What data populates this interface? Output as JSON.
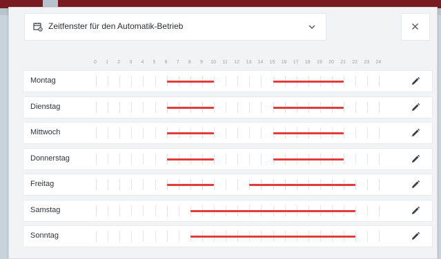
{
  "dialog": {
    "title": "Zeitfenster für den Automatik-Betrieb",
    "title_icon": "calendar-settings-icon",
    "chevron_icon": "chevron-down-icon",
    "close_icon": "close-icon"
  },
  "hours": [
    "0",
    "1",
    "2",
    "3",
    "4",
    "5",
    "6",
    "7",
    "8",
    "9",
    "10",
    "11",
    "12",
    "13",
    "14",
    "15",
    "16",
    "17",
    "18",
    "19",
    "20",
    "21",
    "22",
    "23",
    "24"
  ],
  "days": [
    {
      "name": "Montag",
      "windows": [
        [
          6,
          10
        ],
        [
          15,
          21
        ]
      ]
    },
    {
      "name": "Dienstag",
      "windows": [
        [
          6,
          10
        ],
        [
          15,
          21
        ]
      ]
    },
    {
      "name": "Mittwoch",
      "windows": [
        [
          6,
          10
        ],
        [
          15,
          21
        ]
      ]
    },
    {
      "name": "Donnerstag",
      "windows": [
        [
          6,
          10
        ],
        [
          15,
          21
        ]
      ]
    },
    {
      "name": "Freitag",
      "windows": [
        [
          6,
          10
        ],
        [
          13,
          22
        ]
      ]
    },
    {
      "name": "Samstag",
      "windows": [
        [
          8,
          22
        ]
      ]
    },
    {
      "name": "Sonntag",
      "windows": [
        [
          8,
          22
        ]
      ]
    }
  ],
  "colors": {
    "accent": "#e23b3b",
    "header_bar": "#7a1b22"
  },
  "edit_icon": "pencil-icon"
}
